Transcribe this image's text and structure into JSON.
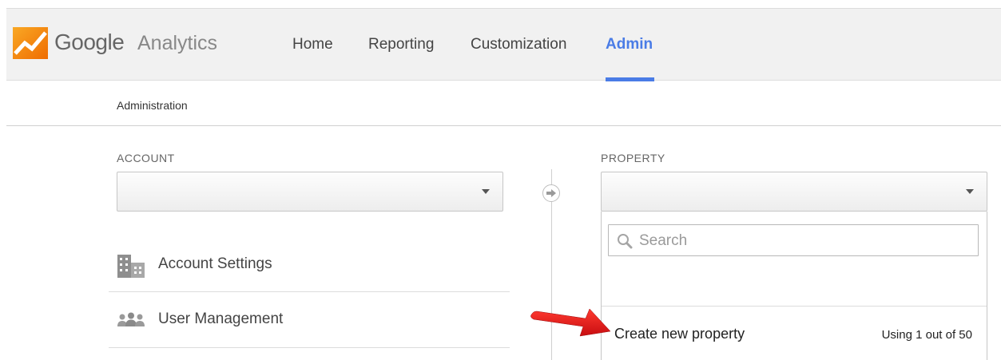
{
  "header": {
    "logo_google": "Google",
    "logo_analytics": "Analytics",
    "nav": [
      {
        "label": "Home"
      },
      {
        "label": "Reporting"
      },
      {
        "label": "Customization"
      },
      {
        "label": "Admin",
        "active": true
      }
    ]
  },
  "breadcrumb": "Administration",
  "account": {
    "label": "ACCOUNT",
    "selected_value": "",
    "menu": [
      {
        "label": "Account Settings",
        "icon": "building-icon"
      },
      {
        "label": "User Management",
        "icon": "users-icon"
      }
    ]
  },
  "property": {
    "label": "PROPERTY",
    "selected_value": "",
    "dropdown": {
      "search_placeholder": "Search",
      "create_label": "Create new property",
      "usage_text": "Using 1 out of 50"
    }
  },
  "colors": {
    "accent_blue": "#4a7ce6",
    "logo_orange": "#f57c1f",
    "annotation_red": "#e8141a"
  }
}
